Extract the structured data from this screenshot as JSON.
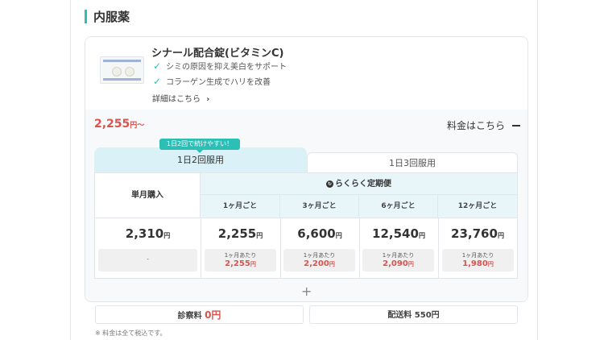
{
  "section": {
    "title": "内服薬"
  },
  "product": {
    "name": "シナール配合錠(ビタミンC)",
    "features": [
      "シミの原因を抑え美白をサポート",
      "コラーゲン生成でハリを改善"
    ],
    "detail_link": "詳細はこちら",
    "detail_arrow": "›"
  },
  "pricing": {
    "from_price": "2,255",
    "from_unit": "円〜",
    "toggle_label": "料金はこちら",
    "tabs": [
      {
        "label": "1日2回服用",
        "active": true
      },
      {
        "label": "1日3回服用",
        "active": false
      }
    ],
    "badge": "1日2回で続けやすい！",
    "single": {
      "label": "単月購入",
      "price": "2,310",
      "unit": "円",
      "sub": "-"
    },
    "subscription_label": "らくらく定期便",
    "subscription_icon": "refresh-icon",
    "plans": [
      {
        "label": "1ヶ月ごと",
        "price": "2,255",
        "per_label": "1ヶ月あたり",
        "per_price": "2,255"
      },
      {
        "label": "3ヶ月ごと",
        "price": "6,600",
        "per_label": "1ヶ月あたり",
        "per_price": "2,200"
      },
      {
        "label": "6ヶ月ごと",
        "price": "12,540",
        "per_label": "1ヶ月あたり",
        "per_price": "2,090"
      },
      {
        "label": "12ヶ月ごと",
        "price": "23,760",
        "per_label": "1ヶ月あたり",
        "per_price": "1,980"
      }
    ],
    "yen": "円",
    "plus": "+",
    "consult_label": "診察料",
    "consult_price": "0円",
    "shipping_label": "配送料 550円",
    "note": "※ 料金は全て税込です。"
  },
  "colors": {
    "accent": "#2bbfb6",
    "price_red": "#d9534f",
    "tab_active_bg": "#d9f1f7"
  }
}
